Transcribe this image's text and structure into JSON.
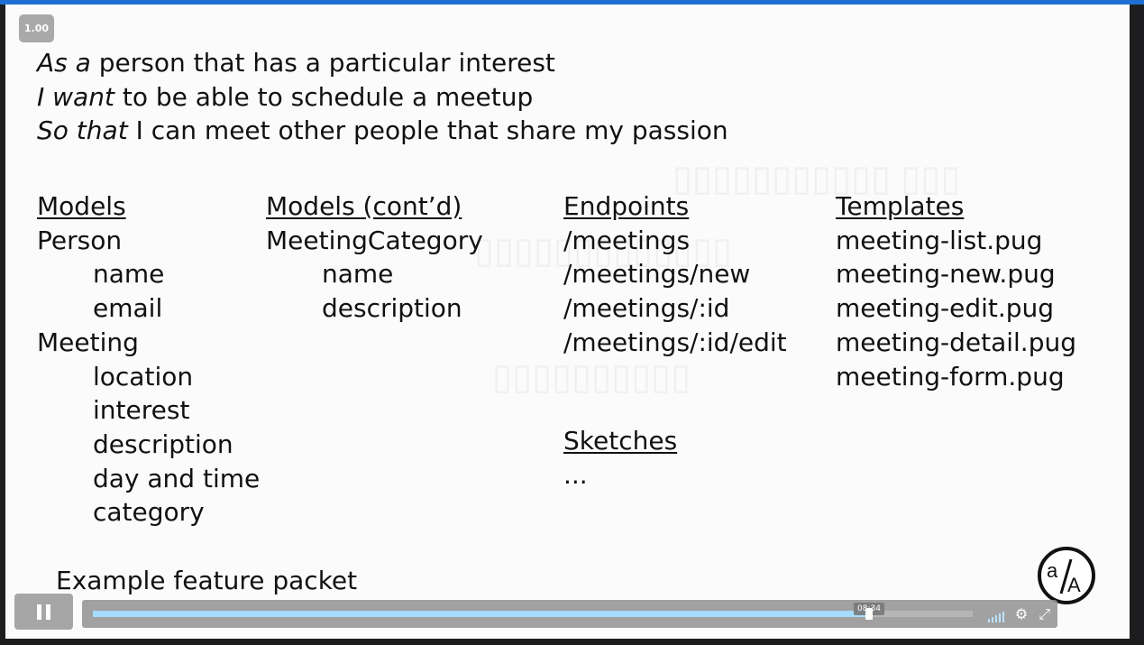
{
  "player": {
    "speed": "1.00",
    "progress": 0.882,
    "time_tooltip": "08:34",
    "colors": {
      "top_bar": "#1f6fd2",
      "progress_fill": "#a6dcff"
    },
    "icons": [
      "pause-icon",
      "volume-icon",
      "gear-icon",
      "fullscreen-icon"
    ]
  },
  "slide": {
    "story": [
      {
        "em": "As a",
        "text": " person that has a particular interest"
      },
      {
        "em": "I want",
        "text": " to be able to schedule a meetup"
      },
      {
        "em": "So that",
        "text": " I can meet other people that share my passion"
      }
    ],
    "models": {
      "heading": "Models",
      "items": [
        "Person",
        "name",
        "email",
        "Meeting",
        "location",
        "interest",
        "description",
        "day and time",
        "category"
      ]
    },
    "models_cont": {
      "heading": "Models (cont’d)",
      "items": [
        "MeetingCategory",
        "name",
        "description"
      ]
    },
    "endpoints": {
      "heading": "Endpoints",
      "items": [
        "/meetings",
        "/meetings/new",
        "/meetings/:id",
        "/meetings/:id/edit"
      ]
    },
    "templates": {
      "heading": "Templates",
      "items": [
        "meeting-list.pug",
        "meeting-new.pug",
        "meeting-edit.pug",
        "meeting-detail.pug",
        "meeting-form.pug"
      ]
    },
    "sketches": {
      "heading": "Sketches",
      "text": "..."
    },
    "caption": "Example feature packet",
    "logo_text": "a/A"
  }
}
